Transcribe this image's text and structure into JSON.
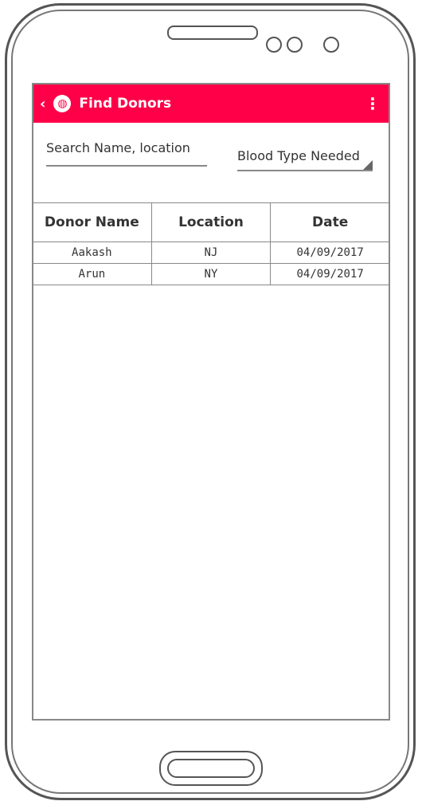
{
  "app": {
    "title": "Find Donors"
  },
  "search": {
    "placeholder": "Search Name, location"
  },
  "blood_type": {
    "selected": "Blood Type Needed"
  },
  "table": {
    "headers": [
      "Donor Name",
      "Location",
      "Date"
    ],
    "rows": [
      [
        "Aakash",
        "NJ",
        "04/09/2017"
      ],
      [
        "Arun",
        "NY",
        "04/09/2017"
      ]
    ]
  },
  "icons": {
    "back": "‹",
    "globe": "🌐",
    "menu": "⋮"
  }
}
